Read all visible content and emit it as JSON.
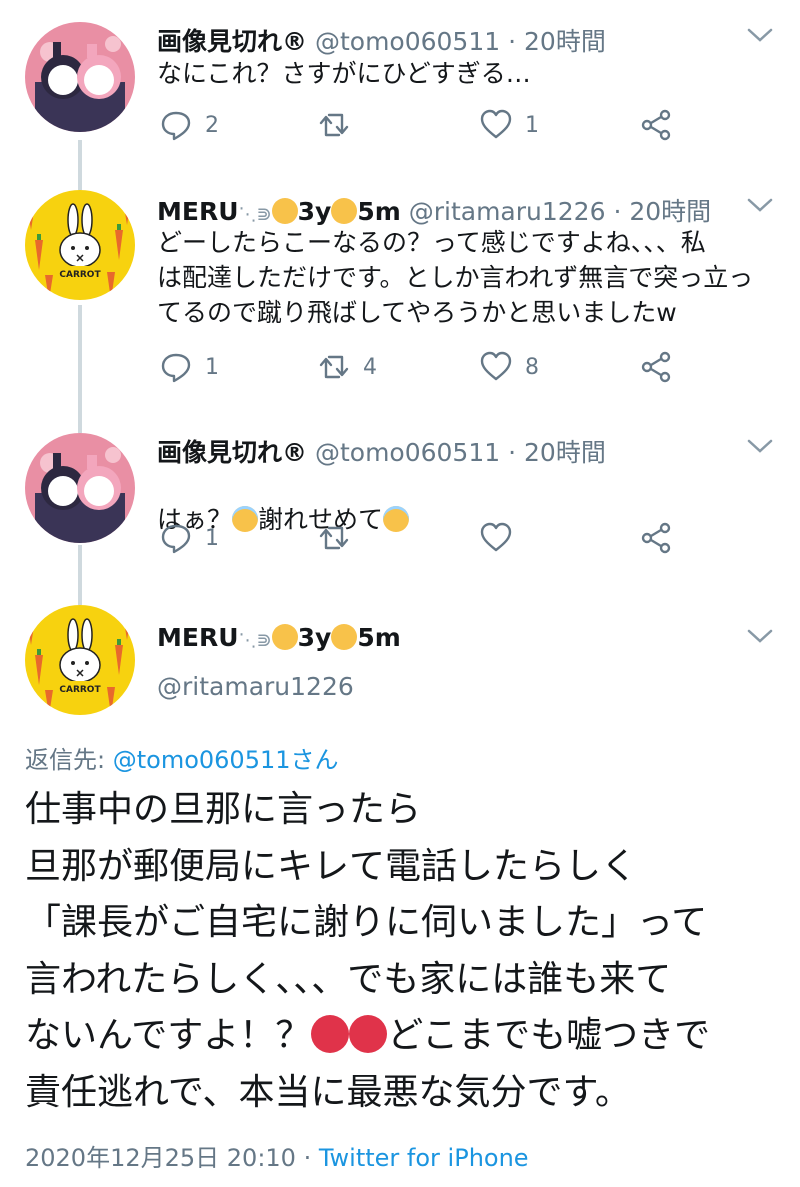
{
  "tweets": [
    {
      "name": "画像見切れ®",
      "handle": "@tomo060511",
      "time": "· 20時間",
      "text": "なにこれ？さすがにひどすぎる…",
      "reply_count": "2",
      "retweet_count": "",
      "like_count": "1"
    },
    {
      "name": "MERU",
      "name_suffix_1": "3y",
      "name_suffix_2": "5m",
      "handle": "@ritamaru1226",
      "time": "· 20時間",
      "text": "どーしたらこーなるの？って感じですよね、、、私\nは配達しただけです。としか言われず無言で突っ立っ\nてるので蹴り飛ばしてやろうかと思いましたw",
      "reply_count": "1",
      "retweet_count": "4",
      "like_count": "8"
    },
    {
      "name": "画像見切れ®",
      "handle": "@tomo060511",
      "time": "· 20時間",
      "text_before": "はぁ？",
      "text_middle": "謝れせめて",
      "reply_count": "1",
      "retweet_count": "",
      "like_count": ""
    }
  ],
  "main_tweet": {
    "name": "MERU",
    "name_suffix_1": "3y",
    "name_suffix_2": "5m",
    "handle": "@ritamaru1226",
    "reply_label": "返信先:",
    "reply_handle": "@tomo060511さん",
    "text_part1": "仕事中の旦那に言ったら\n旦那が郵便局にキレて電話したらしく\n「課長がご自宅に謝りに伺いました」って\n言われたらしく、、、でも家には誰も来て\nないんですよ！？",
    "text_part2": "どこまでも嘘つきで\n責任逃れで、本当に最悪な気分です。",
    "timestamp": "2020年12月25日 20:10 ·",
    "source": "Twitter for iPhone"
  },
  "colors": {
    "text": "#14171a",
    "secondary": "#657786",
    "link": "#1b95e0",
    "thread_line": "#cfd9de"
  },
  "icons": [
    "reply-icon",
    "retweet-icon",
    "like-icon",
    "share-icon",
    "chevron-down-icon",
    "halo-face-emoji",
    "angry-face-emoji"
  ]
}
